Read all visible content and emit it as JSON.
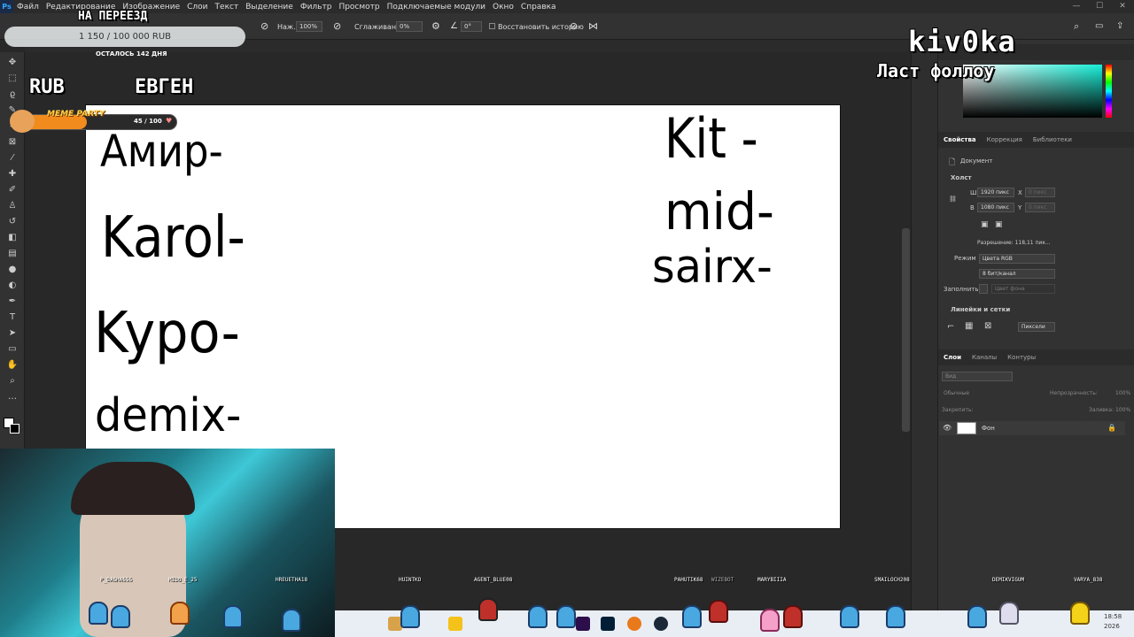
{
  "menu": [
    "Файл",
    "Редактирование",
    "Изображение",
    "Слои",
    "Текст",
    "Выделение",
    "Фильтр",
    "Просмотр",
    "Подключаемые модули",
    "Окно",
    "Справка"
  ],
  "options": {
    "flow_label": "Наж.:",
    "flow_value": "100%",
    "smoothing_label": "Сглаживание:",
    "smoothing_value": "0%",
    "angle_value": "0°",
    "history_label": "Восстановить историю"
  },
  "canvas_text": {
    "left": [
      "Амир-",
      "Karol-",
      "Kypo-",
      "demix-"
    ],
    "right": [
      "Kit -",
      "mid-",
      "sairx-"
    ]
  },
  "properties": {
    "tabs": [
      "Свойства",
      "Коррекция",
      "Библиотеки"
    ],
    "doc_label": "Документ",
    "canvas_section": "Холст",
    "w_label": "Ш",
    "w_value": "1920 пикс",
    "h_label": "В",
    "h_value": "1080 пикс",
    "x_label": "X",
    "x_ph": "0 пикс",
    "y_label": "Y",
    "y_ph": "0 пикс",
    "resolution": "Разрешение: 118,11 пик...",
    "mode_label": "Режим",
    "mode_value": "Цвета RGB",
    "bits_value": "8 бит/канал",
    "fill_label": "Заполнить",
    "fill_value": "Цвет фона",
    "rulers_section": "Линейки и сетки",
    "units_value": "Пиксели"
  },
  "layers": {
    "tabs": [
      "Слои",
      "Каналы",
      "Контуры"
    ],
    "search_ph": "Вид",
    "blend": "Обычные",
    "opacity_label": "Непрозрачность:",
    "opacity": "100%",
    "lock_label": "Закрепить:",
    "fill_label": "Заливка:",
    "fill": "100%",
    "layer_name": "Фон"
  },
  "overlay": {
    "goal_title": "НА ПЕРЕЕЗД",
    "goal_amount": "1 150 / 100 000 RUB",
    "goal_days": "ОСТАЛОСЬ 142 ДНЯ",
    "top_left_1": "RUB",
    "top_left_2": "ЕВГЕН",
    "meme_label": "MEME PARTY",
    "meme_count": "45 / 100",
    "meme_progress": 0.45,
    "kivoka": "kiv0ka",
    "last_follow": "Ласт фоллоу"
  },
  "viewers": [
    "P_DASHA555",
    "MIDO_E_25",
    "HREUETHA18",
    "HUINTKO",
    "AGENT_BLUE08",
    "PAHUTIK68",
    "WIZEBOT",
    "MARYBIIIA",
    "SMAILOCH208",
    "DEMIKVIGUM",
    "VARYA_838"
  ],
  "clock": {
    "time": "18:58",
    "year": "2026"
  },
  "colors": {
    "accent": "#31a8ff",
    "canvas": "#ffffff",
    "panel": "#323232"
  }
}
